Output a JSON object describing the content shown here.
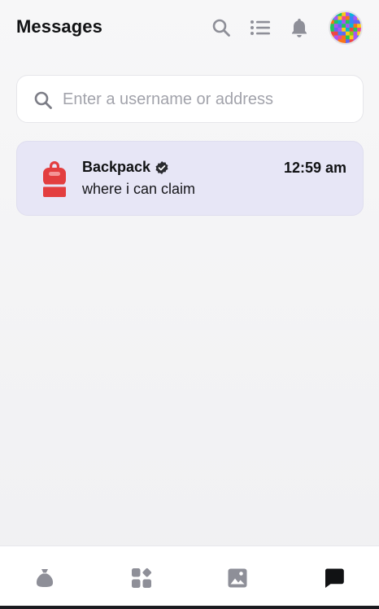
{
  "header": {
    "title": "Messages"
  },
  "search": {
    "placeholder": "Enter a username or address",
    "value": ""
  },
  "messages": [
    {
      "sender": "Backpack",
      "verified": true,
      "time": "12:59 am",
      "preview": "where i can claim"
    }
  ],
  "colors": {
    "accent": "#e33e3f",
    "card_bg": "#e7e6f6",
    "icon_gray": "#8e8f98",
    "text": "#111214"
  },
  "icons": {
    "header": [
      "search-icon",
      "list-icon",
      "bell-icon"
    ],
    "nav": [
      "bag-icon",
      "apps-icon",
      "image-icon",
      "chat-icon"
    ]
  }
}
